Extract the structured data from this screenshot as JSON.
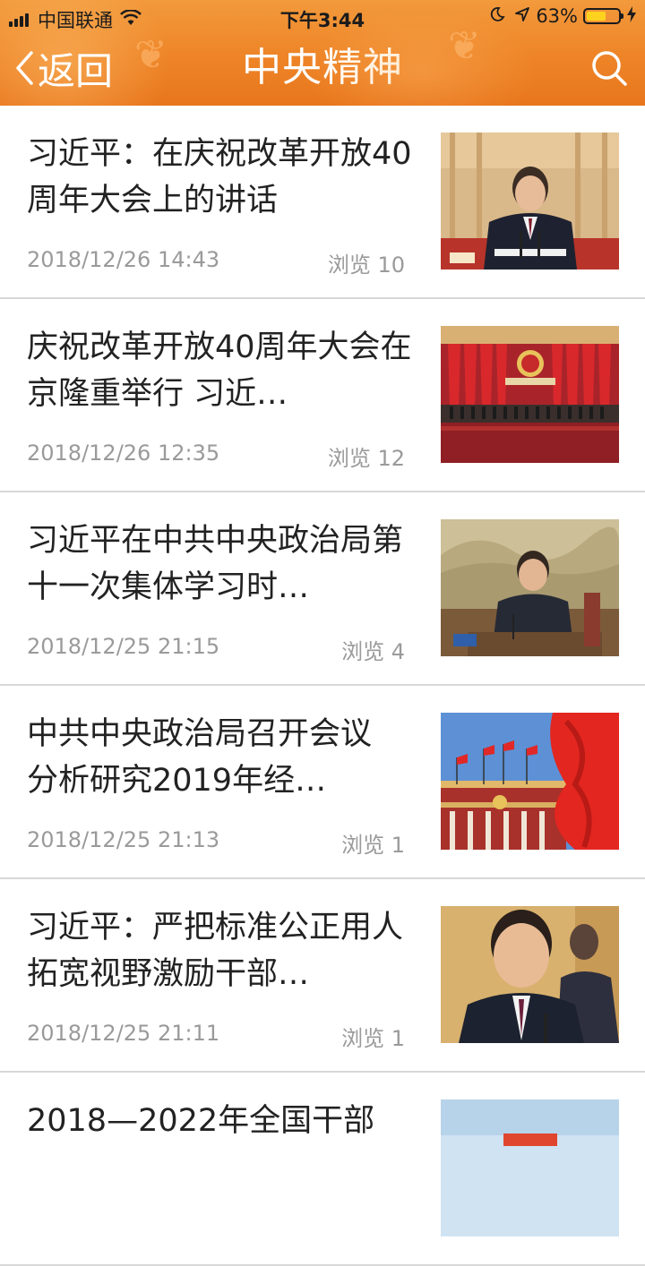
{
  "status_bar": {
    "carrier": "中国联通",
    "time": "下午3:44",
    "battery": "63%",
    "battery_level": 0.63,
    "icons": [
      "signal-icon",
      "wifi-icon",
      "moon-icon",
      "location-arrow-icon",
      "battery-icon",
      "charging-bolt-icon"
    ]
  },
  "nav": {
    "back_label": "返回",
    "title": "中央精神",
    "search_icon": "search-icon"
  },
  "colors": {
    "header": "#ee8427",
    "text": "#222222",
    "meta": "#9a9a9a",
    "divider": "#d8d8d8"
  },
  "articles": [
    {
      "title": "习近平：在庆祝改革开放40周年大会上的讲话",
      "date": "2018/12/26 14:43",
      "views": "浏览 10",
      "thumb": "speaker-at-podium"
    },
    {
      "title": "庆祝改革开放40周年大会在京隆重举行 习近…",
      "date": "2018/12/26 12:35",
      "views": "浏览 12",
      "thumb": "great-hall-stage"
    },
    {
      "title": "习近平在中共中央政治局第十一次集体学习时…",
      "date": "2018/12/25 21:15",
      "views": "浏览 4",
      "thumb": "speaker-with-painting"
    },
    {
      "title": "中共中央政治局召开会议 分析研究2019年经…",
      "date": "2018/12/25 21:13",
      "views": "浏览 1",
      "thumb": "flags-and-building"
    },
    {
      "title": "习近平：严把标准公正用人拓宽视野激励干部…",
      "date": "2018/12/25 21:11",
      "views": "浏览 1",
      "thumb": "speaker-closeup"
    },
    {
      "title": "2018—2022年全国干部",
      "date": "",
      "views": "",
      "thumb": "poster"
    }
  ]
}
